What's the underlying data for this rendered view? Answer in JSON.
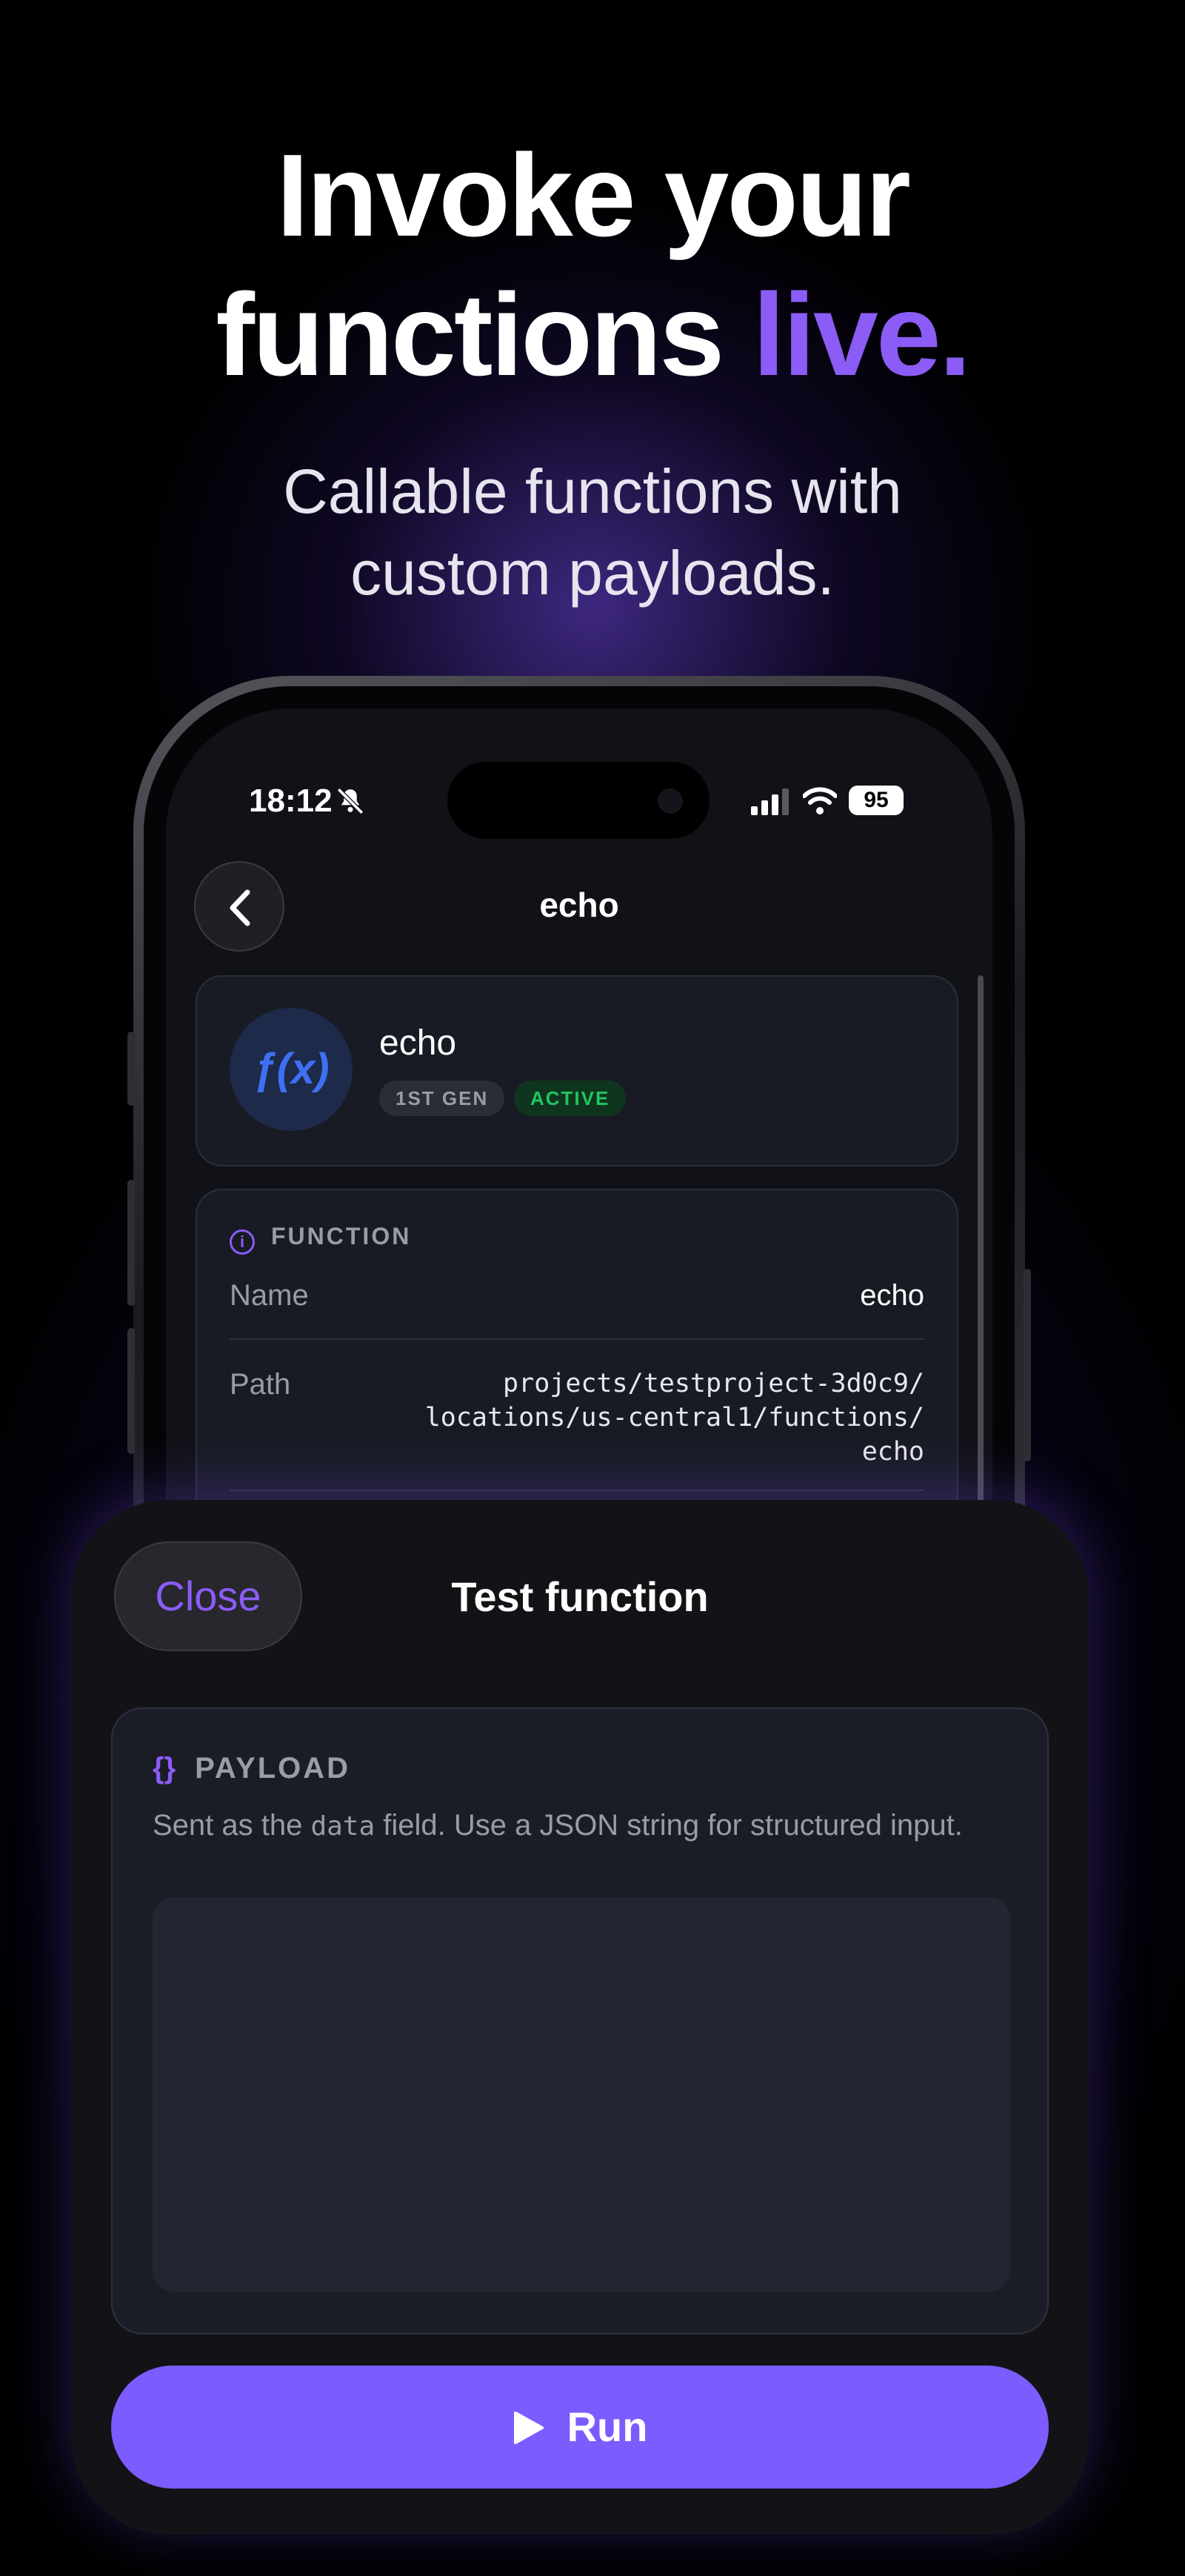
{
  "hero": {
    "headline_line1": "Invoke your",
    "headline_line2_prefix": "functions ",
    "headline_line2_accent": "live.",
    "subhead_line1": "Callable functions with",
    "subhead_line2": "custom payloads."
  },
  "status_bar": {
    "time": "18:12",
    "battery": "95",
    "icons": [
      "bell-slash-icon",
      "signal-icon",
      "wifi-icon",
      "battery-icon"
    ]
  },
  "nav": {
    "title": "echo",
    "back_icon": "chevron-left-icon"
  },
  "function_card": {
    "icon_text": "ƒ(x)",
    "name": "echo",
    "badges": [
      "1ST GEN",
      "ACTIVE"
    ]
  },
  "details": {
    "section_title": "FUNCTION",
    "rows": [
      {
        "label": "Name",
        "value": "echo"
      },
      {
        "label": "Path",
        "value_lines": [
          "projects/testproject-3d0c9/",
          "locations/us-central1/functions/",
          "echo"
        ]
      }
    ]
  },
  "sheet": {
    "close_label": "Close",
    "title": "Test function",
    "payload": {
      "icon_text": "{}",
      "heading": "PAYLOAD",
      "desc_before": "Sent as the ",
      "desc_code": "data",
      "desc_after": " field. Use a JSON string for structured input.",
      "value": ""
    },
    "run_label": "Run"
  },
  "colors": {
    "accent": "#8b5cf6",
    "run_button": "#7c5cff",
    "active_badge": "#22c55e",
    "fx_icon": "#3f6ff2"
  }
}
